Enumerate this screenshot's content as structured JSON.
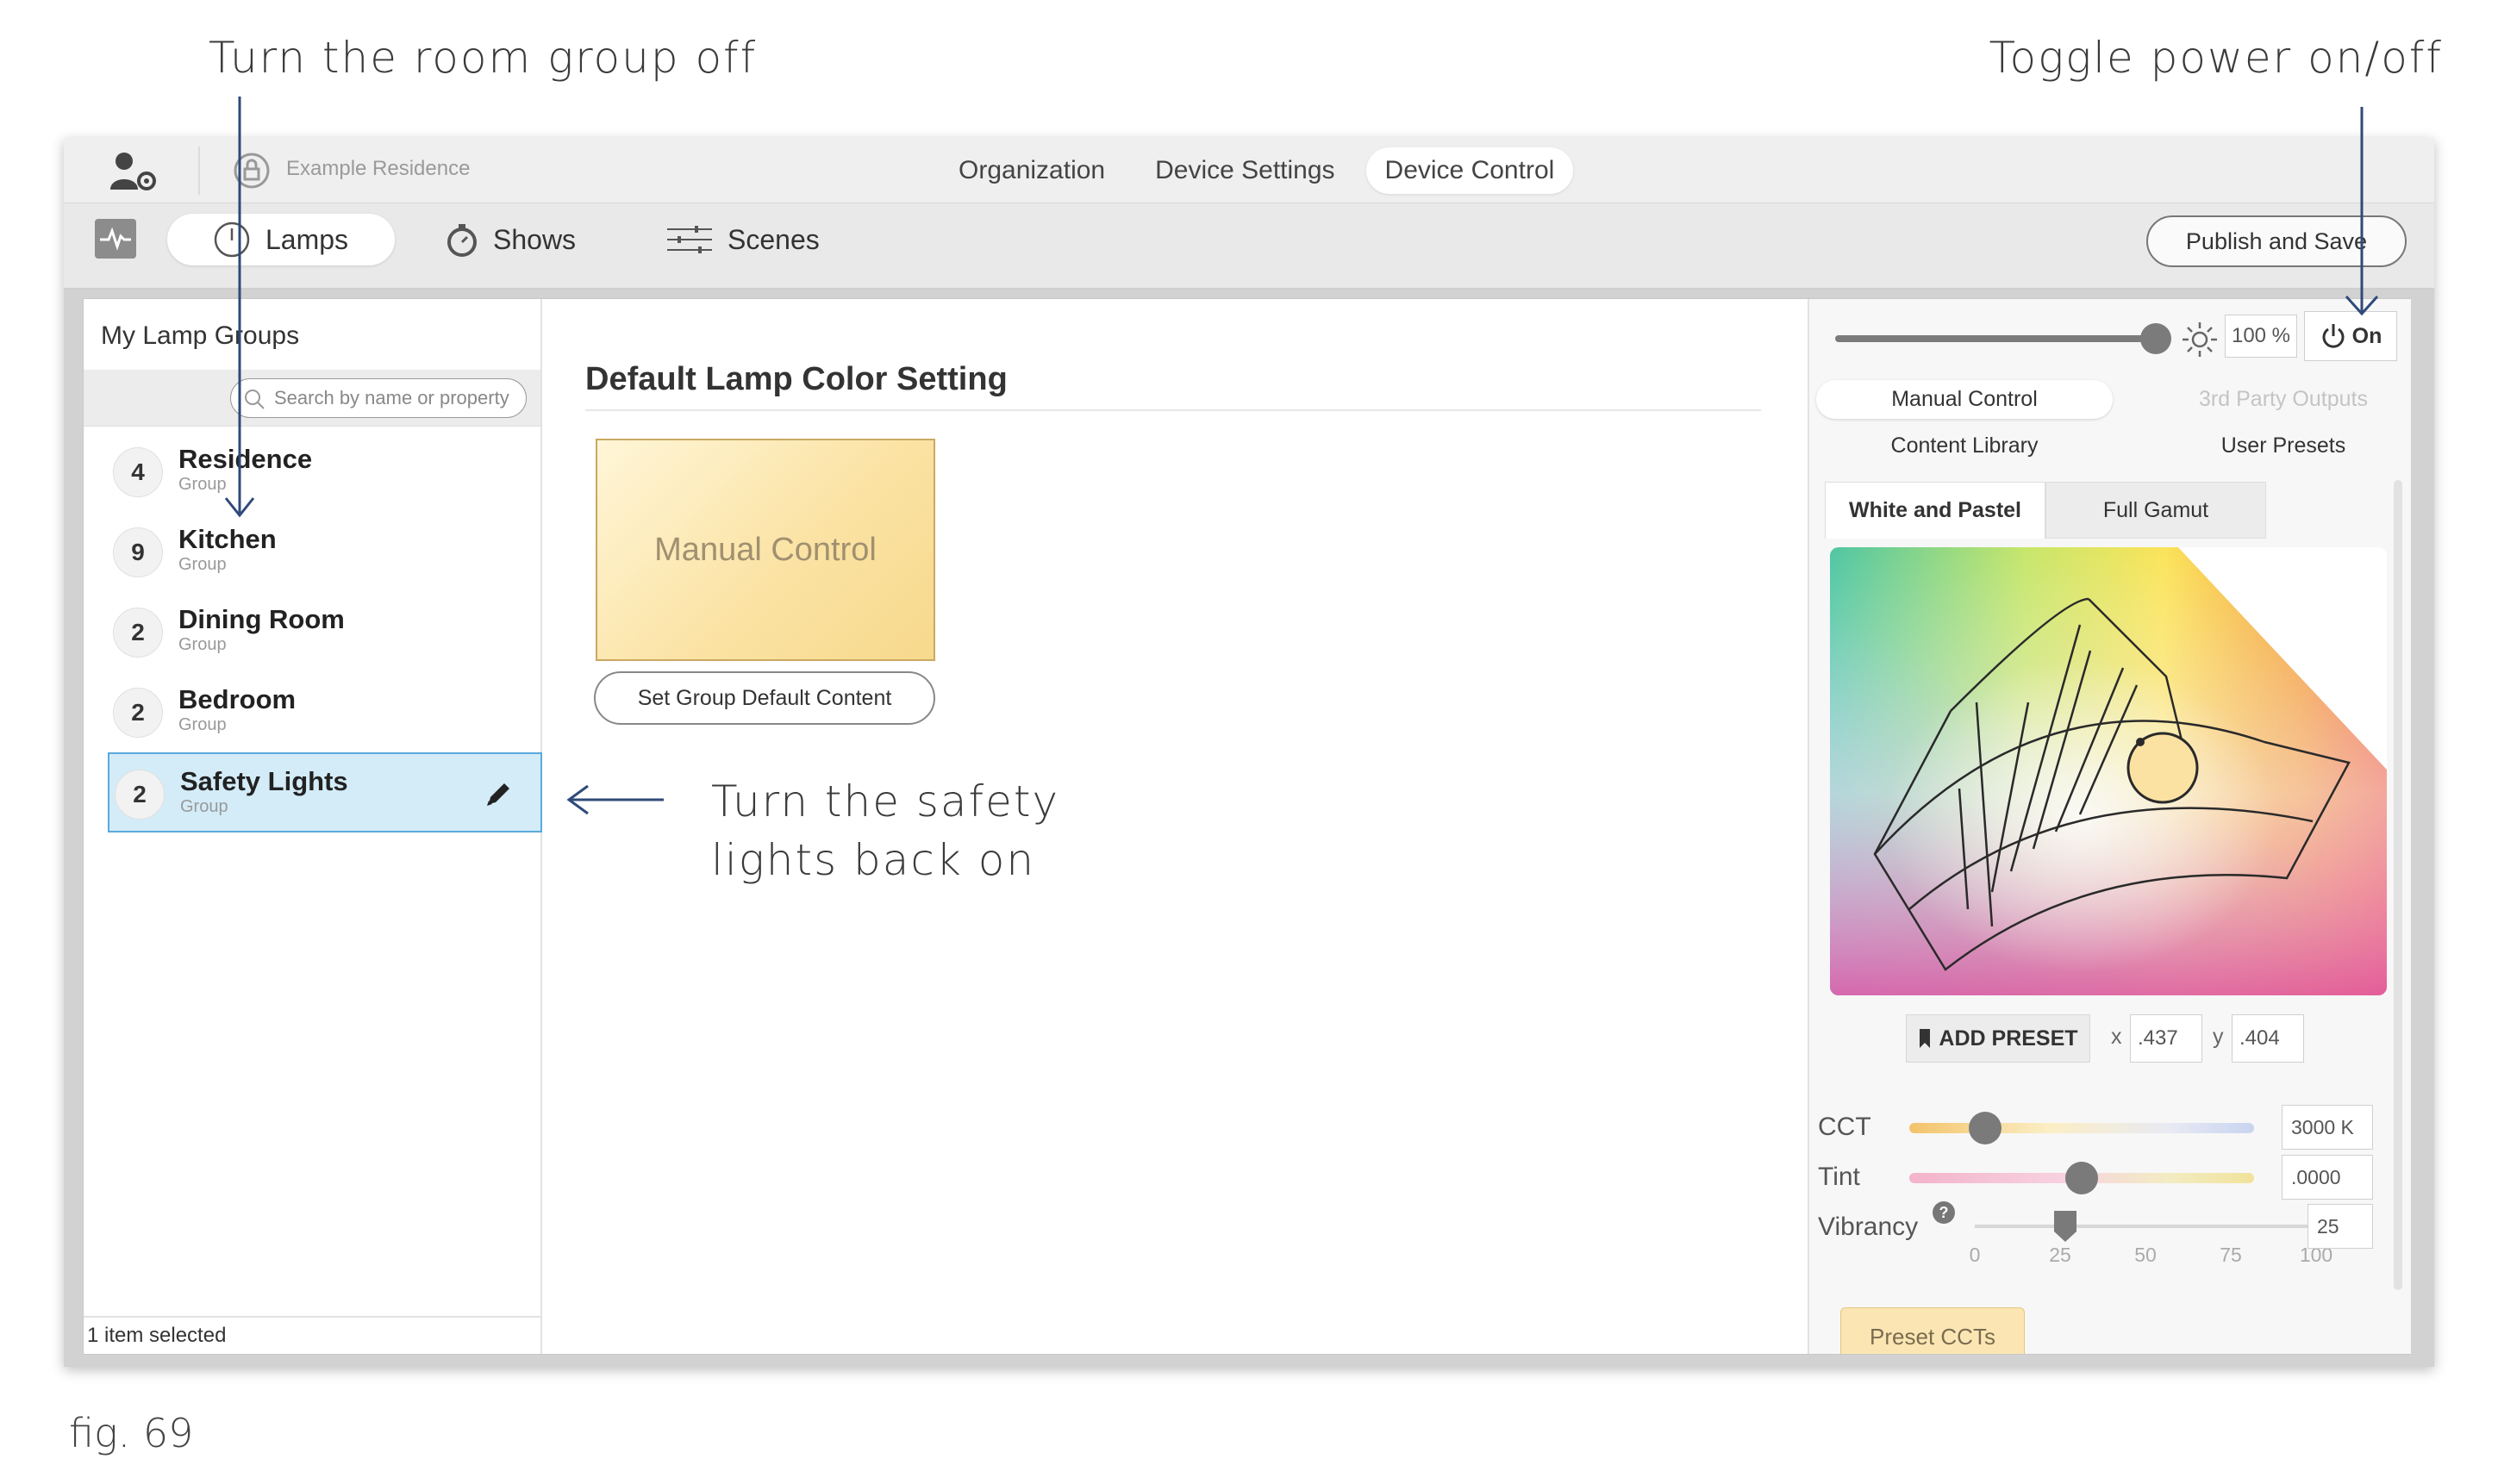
{
  "callouts": {
    "top_left": "Turn the room group off",
    "top_right": "Toggle power on/off",
    "middle_line1": "Turn the safety",
    "middle_line2": "lights back on",
    "figure": "fig. 69"
  },
  "topbar": {
    "residence": "Example Residence",
    "nav": [
      "Organization",
      "Device Settings",
      "Device Control"
    ],
    "active_nav": "Device Control"
  },
  "toolbar": {
    "tabs": [
      "Lamps",
      "Shows",
      "Scenes"
    ],
    "active_tab": "Lamps",
    "publish_label": "Publish and Save"
  },
  "left_panel": {
    "title": "My Lamp Groups",
    "search_placeholder": "Search by name or property",
    "groups": [
      {
        "count": "4",
        "name": "Residence",
        "type": "Group"
      },
      {
        "count": "9",
        "name": "Kitchen",
        "type": "Group"
      },
      {
        "count": "2",
        "name": "Dining Room",
        "type": "Group"
      },
      {
        "count": "2",
        "name": "Bedroom",
        "type": "Group"
      },
      {
        "count": "2",
        "name": "Safety Lights",
        "type": "Group",
        "selected": true
      }
    ],
    "footer": "1 item selected"
  },
  "middle_panel": {
    "title": "Default Lamp Color Setting",
    "swatch_label": "Manual Control",
    "set_default_label": "Set Group Default Content"
  },
  "right_panel": {
    "brightness": "100 %",
    "brightness_level": 1.0,
    "power_label": "On",
    "tabs": {
      "manual": "Manual Control",
      "third_party": "3rd Party Outputs",
      "content_library": "Content Library",
      "user_presets": "User Presets"
    },
    "gamut_tabs": [
      "White and Pastel",
      "Full Gamut"
    ],
    "add_preset": "ADD PRESET",
    "x_label": "x",
    "x_value": ".437",
    "y_label": "y",
    "y_value": ".404",
    "cct_label": "CCT",
    "cct_value": "3000 K",
    "cct_position": 0.22,
    "tint_label": "Tint",
    "tint_value": ".0000",
    "tint_position": 0.5,
    "vibrancy_label": "Vibrancy",
    "vibrancy_value": "25",
    "vibrancy_ticks": [
      "0",
      "25",
      "50",
      "75",
      "100"
    ],
    "preset_cct_label": "Preset CCTs"
  },
  "colors": {
    "accent_selected": "#d3ecf8",
    "selected_border": "#5aa9dc",
    "callout_arrow": "#2f4a7a",
    "swatch": "#fbe3a5"
  }
}
